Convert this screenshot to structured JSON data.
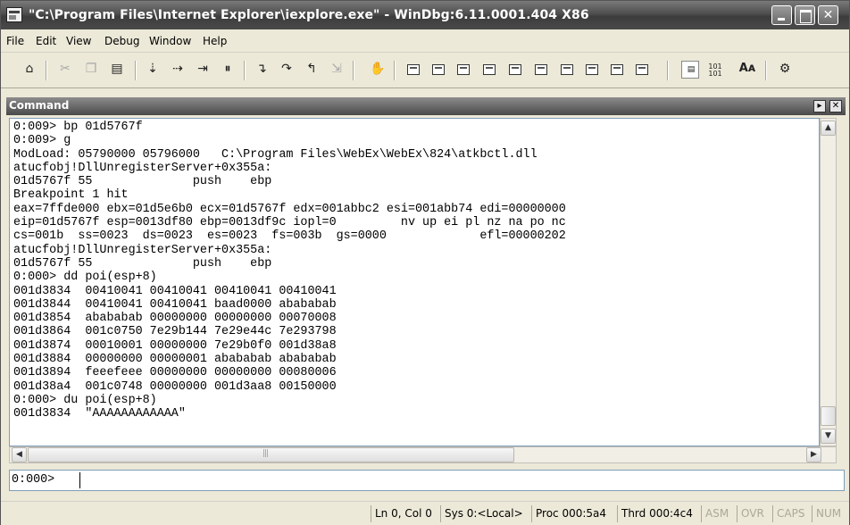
{
  "window": {
    "title": "\"C:\\Program Files\\Internet Explorer\\iexplore.exe\" - WinDbg:6.11.0001.404 X86",
    "app_icon": "windbg-app-icon",
    "controls": [
      "minimize-icon",
      "maximize-icon",
      "close-icon"
    ]
  },
  "menu": [
    "File",
    "Edit",
    "View",
    "Debug",
    "Window",
    "Help"
  ],
  "toolbar": {
    "buttons": [
      {
        "name": "open-file-icon",
        "enabled": true
      },
      {
        "name": "cut-icon",
        "enabled": false
      },
      {
        "name": "copy-icon",
        "enabled": false
      },
      {
        "name": "paste-icon",
        "enabled": true
      },
      {
        "name": "go-icon",
        "enabled": true
      },
      {
        "name": "restart-icon",
        "enabled": true
      },
      {
        "name": "stop-debugging-icon",
        "enabled": true
      },
      {
        "name": "break-icon",
        "enabled": true
      },
      {
        "name": "step-into-icon",
        "enabled": true
      },
      {
        "name": "step-over-icon",
        "enabled": true
      },
      {
        "name": "step-out-icon",
        "enabled": true
      },
      {
        "name": "run-to-cursor-icon",
        "enabled": false
      },
      {
        "name": "insert-breakpoint-icon",
        "enabled": true
      },
      {
        "name": "command-window-icon",
        "enabled": true
      },
      {
        "name": "watch-window-icon",
        "enabled": true
      },
      {
        "name": "locals-window-icon",
        "enabled": true
      },
      {
        "name": "registers-window-icon",
        "enabled": true
      },
      {
        "name": "memory-window-icon",
        "enabled": true
      },
      {
        "name": "call-stack-window-icon",
        "enabled": true
      },
      {
        "name": "disassembly-window-icon",
        "enabled": true
      },
      {
        "name": "scratch-pad-icon",
        "enabled": true
      },
      {
        "name": "processes-threads-icon",
        "enabled": true
      },
      {
        "name": "source-mode-icon",
        "enabled": true
      },
      {
        "name": "hex-mode-icon",
        "enabled": true
      },
      {
        "name": "font-icon",
        "enabled": true
      },
      {
        "name": "options-icon",
        "enabled": true
      }
    ]
  },
  "command_window": {
    "title": "Command",
    "output_lines": [
      "0:009> bp 01d5767f",
      "0:009> g",
      "ModLoad: 05790000 05796000   C:\\Program Files\\WebEx\\WebEx\\824\\atkbctl.dll",
      "atucfobj!DllUnregisterServer+0x355a:",
      "01d5767f 55              push    ebp",
      "Breakpoint 1 hit",
      "eax=7ffde000 ebx=01d5e6b0 ecx=01d5767f edx=001abbc2 esi=001abb74 edi=00000000",
      "eip=01d5767f esp=0013df80 ebp=0013df9c iopl=0         nv up ei pl nz na po nc",
      "cs=001b  ss=0023  ds=0023  es=0023  fs=003b  gs=0000             efl=00000202",
      "atucfobj!DllUnregisterServer+0x355a:",
      "01d5767f 55              push    ebp",
      "0:000> dd poi(esp+8)",
      "001d3834  00410041 00410041 00410041 00410041",
      "001d3844  00410041 00410041 baad0000 abababab",
      "001d3854  abababab 00000000 00000000 00070008",
      "001d3864  001c0750 7e29b144 7e29e44c 7e293798",
      "001d3874  00010001 00000000 7e29b0f0 001d38a8",
      "001d3884  00000000 00000001 abababab abababab",
      "001d3894  feeefeee 00000000 00000000 00080006",
      "001d38a4  001c0748 00000000 001d3aa8 00150000",
      "0:000> du poi(esp+8)",
      "001d3834  \"AAAAAAAAAAAA\""
    ],
    "prompt": "0:000>",
    "input_value": ""
  },
  "status": {
    "position": "Ln 0, Col 0",
    "system": "Sys 0:<Local>",
    "process": "Proc 000:5a4",
    "thread": "Thrd 000:4c4",
    "asm": "ASM",
    "ovr": "OVR",
    "caps": "CAPS",
    "num": "NUM"
  }
}
